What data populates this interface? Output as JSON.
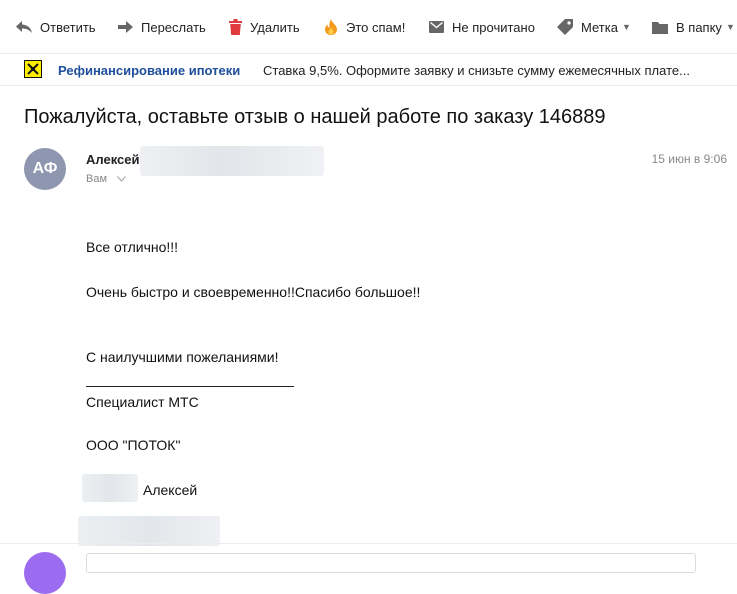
{
  "toolbar": {
    "reply": "Ответить",
    "forward": "Переслать",
    "delete": "Удалить",
    "spam": "Это спам!",
    "unread": "Не прочитано",
    "label": "Метка",
    "folder": "В папку"
  },
  "ad": {
    "title": "Рефинансирование ипотеки",
    "text": "Ставка 9,5%. Оформите заявку и снизьте сумму ежемесячных плате..."
  },
  "message": {
    "subject": "Пожалуйста, оставьте отзыв о нашей работе по заказу 146889",
    "avatar_initials": "АФ",
    "sender_name": "Алексей",
    "recipient": "Вам",
    "date": "15 июн в 9:06",
    "body": {
      "line1": "Все отлично!!!",
      "line2": "Очень быстро и своевременно!!Спасибо большое!!",
      "line3": "С наилучшими пожеланиями!",
      "line4": "Специалист МТС",
      "line5": "ООО \"ПОТОК\"",
      "line6": "Алексей"
    }
  },
  "colors": {
    "ad_title": "#1f4f9c",
    "avatar_bg": "#8f97b0",
    "delete_icon": "#e0393e",
    "spam_icon": "#f59b1b"
  }
}
